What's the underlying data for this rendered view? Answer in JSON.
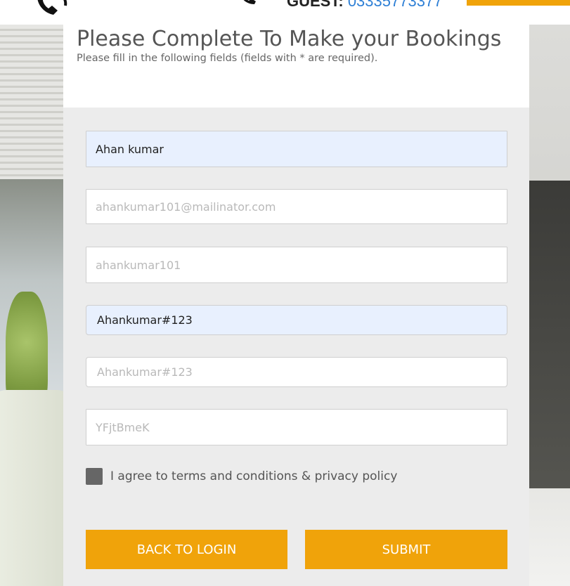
{
  "header": {
    "guest_label": "GUEST:",
    "guest_phone": "03335773377"
  },
  "form": {
    "title": "Please Complete To Make your Bookings",
    "subtitle": "Please fill in the following fields (fields with * are required).",
    "name_value": "Ahan kumar",
    "email_placeholder": "ahankumar101@mailinator.com",
    "username_placeholder": "ahankumar101",
    "password_value": "Ahankumar#123",
    "confirm_password_placeholder": "Ahankumar#123",
    "captcha_placeholder": "YFjtBmeK",
    "agree_text": "I agree to terms and conditions & privacy policy",
    "back_button": "BACK TO LOGIN",
    "submit_button": "SUBMIT"
  },
  "colors": {
    "accent": "#f0a30a",
    "link": "#2f80d6",
    "autofill": "#e8f0fe"
  },
  "icons": [
    "phone-icon"
  ]
}
